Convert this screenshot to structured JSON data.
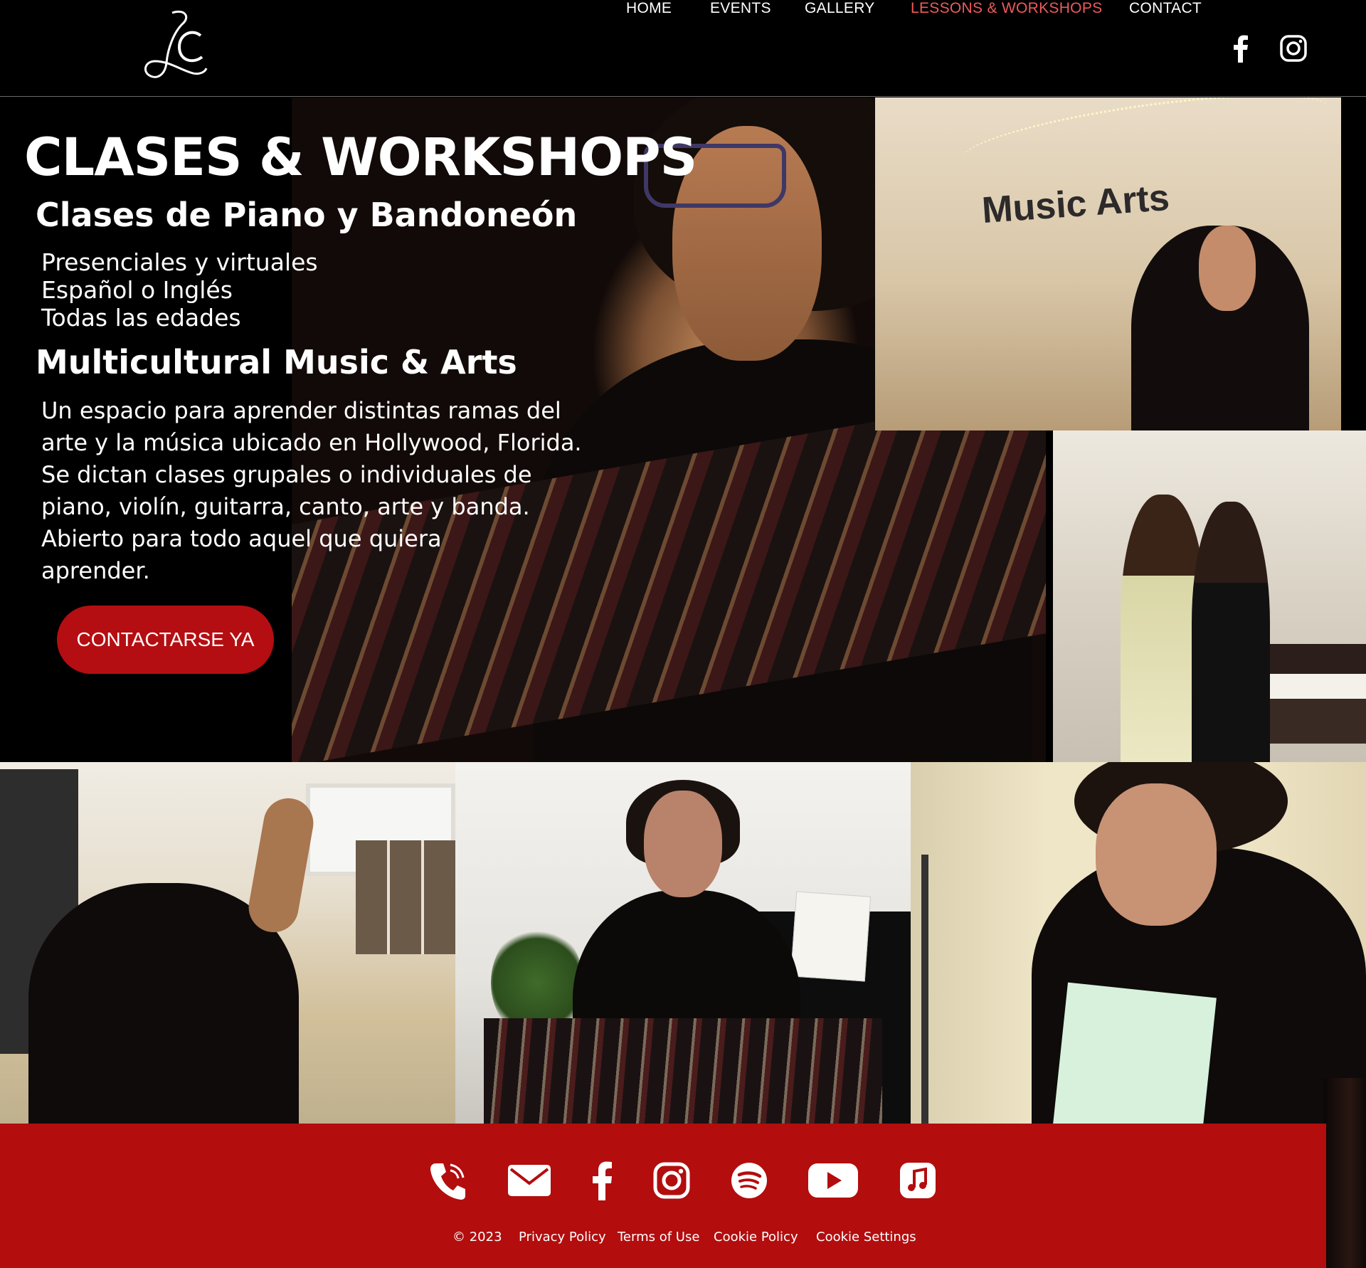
{
  "header": {
    "logo_text": "LC",
    "nav": [
      {
        "label": "HOME",
        "active": false
      },
      {
        "label": "EVENTS",
        "active": false
      },
      {
        "label": "GALLERY",
        "active": false
      },
      {
        "label": "LESSONS & WORKSHOPS",
        "active": true
      },
      {
        "label": "CONTACT",
        "active": false
      }
    ],
    "social_icons": [
      "facebook-icon",
      "instagram-icon"
    ]
  },
  "hero": {
    "title": "CLASES & WORKSHOPS",
    "subtitle1": "Clases de Piano y Bandoneón",
    "list": [
      "Presenciales y virtuales",
      "Español o Inglés",
      "Todas las edades"
    ],
    "subtitle2": "Multicultural Music & Arts",
    "body_lines": [
      "Un espacio para aprender distintas ramas del",
      "arte y la música ubicado en Hollywood, Florida.",
      "Se dictan clases grupales o individuales de",
      "piano, violín, guitarra, canto, arte y banda.",
      "Abierto para todo aquel que quiera",
      "aprender."
    ],
    "cta_label": "CONTACTARSE YA",
    "photo_sign_text": "Music Arts"
  },
  "footer": {
    "icons": [
      "phone-icon",
      "email-icon",
      "facebook-icon",
      "instagram-icon",
      "spotify-icon",
      "youtube-icon",
      "apple-music-icon"
    ],
    "copyright": "© 2023",
    "links": [
      "Privacy Policy",
      "Terms of Use",
      "Cookie Policy",
      "Cookie Settings"
    ]
  },
  "colors": {
    "accent_red": "#b30d0e",
    "nav_active": "#ef5a5a",
    "background": "#000000",
    "text": "#ffffff"
  }
}
